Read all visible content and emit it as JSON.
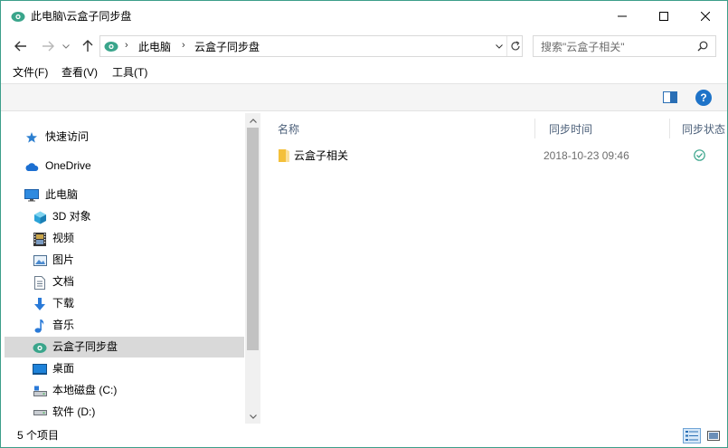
{
  "window": {
    "title": "此电脑\\云盒子同步盘",
    "accent": "#3c9e8a"
  },
  "address": {
    "crumbs": [
      "此电脑",
      "云盒子同步盘"
    ],
    "separator": "›"
  },
  "search": {
    "placeholder": "搜索\"云盒子相关\""
  },
  "menu": {
    "items": [
      "文件(F)",
      "查看(V)",
      "工具(T)"
    ]
  },
  "nav": {
    "items": [
      {
        "label": "快速访问",
        "icon": "pin-star-icon"
      },
      {
        "label": "OneDrive",
        "icon": "cloud-icon"
      },
      {
        "label": "此电脑",
        "icon": "monitor-icon"
      },
      {
        "label": "3D 对象",
        "icon": "cube-3d-icon"
      },
      {
        "label": "视频",
        "icon": "film-icon"
      },
      {
        "label": "图片",
        "icon": "picture-icon"
      },
      {
        "label": "文档",
        "icon": "document-icon"
      },
      {
        "label": "下载",
        "icon": "download-arrow-icon"
      },
      {
        "label": "音乐",
        "icon": "music-note-icon"
      },
      {
        "label": "云盒子同步盘",
        "icon": "cloudbox-icon"
      },
      {
        "label": "桌面",
        "icon": "desktop-icon"
      },
      {
        "label": "本地磁盘 (C:)",
        "icon": "drive-icon"
      },
      {
        "label": "软件 (D:)",
        "icon": "drive-icon"
      }
    ],
    "selected": "云盒子同步盘"
  },
  "columns": {
    "name": "名称",
    "date": "同步时间",
    "status": "同步状态"
  },
  "files": [
    {
      "name": "云盒子相关",
      "date": "2018-10-23 09:46",
      "status_icon": "synced-check-icon"
    }
  ],
  "status": {
    "count": "5 个项目"
  }
}
